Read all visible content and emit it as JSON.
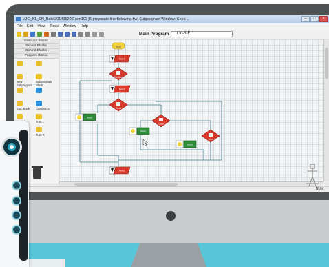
{
  "window": {
    "title": "VJC_K1_EN_Build20140520  Econ102  [5 greyscale line following.flw]   Subprogram Window: Seek L",
    "controls": [
      "–",
      "□",
      "×"
    ]
  },
  "menu": [
    "File",
    "Edit",
    "View",
    "Tools",
    "Window",
    "Help"
  ],
  "toolbar": {
    "program_label": "Main Program",
    "subprogram_value": "Lin-5-E"
  },
  "palette": {
    "headers": [
      "Executor Blocks",
      "Sensor Blocks",
      "Control Blocks",
      "Program Blocks"
    ],
    "items": [
      {
        "label": "",
        "color": "#e8c12a"
      },
      {
        "label": "",
        "color": "#e8c12a"
      },
      {
        "label": "New Subprogram",
        "color": "#e8c12a"
      },
      {
        "label": "Subprogram Block",
        "color": "#e8c12a"
      },
      {
        "label": "",
        "color": "#e8c12a"
      },
      {
        "label": "",
        "color": "#2a8fd8"
      },
      {
        "label": "End Block",
        "color": "#e8c12a"
      },
      {
        "label": "Customize",
        "color": "#2a8fd8"
      },
      {
        "label": "Seek L",
        "color": "#e8c12a"
      },
      {
        "label": "Turn L",
        "color": "#e8c12a"
      },
      {
        "label": "Seek R",
        "color": "#e8c12a"
      },
      {
        "label": "Turn R",
        "color": "#e8c12a"
      }
    ]
  },
  "flowchart": {
    "start_label": "Start",
    "nodes": [
      {
        "kind": "start",
        "label": "Start"
      },
      {
        "kind": "io",
        "label": "Fwd1"
      },
      {
        "kind": "cond",
        "label": "Condition"
      },
      {
        "kind": "io",
        "label": "Fwd2"
      },
      {
        "kind": "cond",
        "label": "Cond"
      },
      {
        "kind": "act",
        "label": "Seek"
      },
      {
        "kind": "cond",
        "label": "Cond"
      },
      {
        "kind": "act",
        "label": "Seek"
      },
      {
        "kind": "cond",
        "label": "Cond"
      },
      {
        "kind": "act",
        "label": "Seek"
      },
      {
        "kind": "io",
        "label": "Fwd3"
      }
    ]
  },
  "status": {
    "num": "NUM"
  },
  "colors": {
    "cond_red": "#d73a2b",
    "act_green": "#2e8b3a",
    "start_yellow": "#f2d23a",
    "accent": "#2ba7bd"
  }
}
